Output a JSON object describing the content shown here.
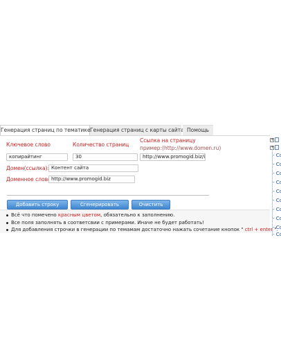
{
  "tabs": [
    {
      "label": "Генерация страниц по тематике",
      "active": true
    },
    {
      "label": "Генерация страниц с карты сайта",
      "active": false
    },
    {
      "label": "Помощь",
      "active": false
    }
  ],
  "form": {
    "keyword_label": "Ключевое слово",
    "count_label": "Количество страниц",
    "link_label": "Ссылка на страницу",
    "link_hint": "пример:(http://www.domen.ru)",
    "keyword_value": "копирайтинг",
    "count_value": "30",
    "link_value": "http://www.promogid.biz/ind",
    "domain_link_label": "Домен(ссылка):",
    "domain_link_value": "Контент сайта",
    "domain_word_label": "Доменное слово:",
    "domain_word_value": "http://www.promogid.biz"
  },
  "buttons": {
    "add_row": "Добавить строку",
    "generate": "Сгенерировать",
    "clear": "Очистить"
  },
  "notes": {
    "n1_pre": "Всё что помечено ",
    "n1_red": "красным цветом",
    "n1_post": ", обязательно к заполнению.",
    "n2": "Все поля заполнять в соответсвии с примерами. Иначе не будет работать!",
    "n3_pre": "Для добавления строчки в генерации по темамам достаточно нажать сочетание кнопок \"",
    "n3_red": " ctrl + enter ",
    "n3_post": "\"."
  },
  "tree": {
    "item_label": "- Co",
    "expand_symbol": "+"
  },
  "colors": {
    "required_red": "#c81e1e",
    "button_blue": "#3f86cf",
    "tree_link": "#1b4f96"
  }
}
